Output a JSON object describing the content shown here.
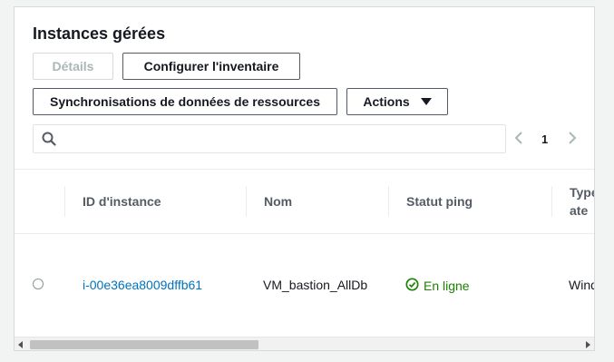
{
  "panel": {
    "title": "Instances gérées",
    "buttons": {
      "details": "Détails",
      "configure_inventory": "Configurer l'inventaire",
      "resource_data_sync": "Synchronisations de données de ressources",
      "actions": "Actions"
    }
  },
  "search": {
    "placeholder": "",
    "value": ""
  },
  "pagination": {
    "current_page": "1"
  },
  "table": {
    "columns": [
      "ID d'instance",
      "Nom",
      "Statut ping",
      "Type plate"
    ],
    "rows": [
      {
        "instance_id": "i-00e36ea8009dffb61",
        "name": "VM_bastion_AllDb",
        "ping_status": "En ligne",
        "platform_type": "Wind"
      }
    ]
  },
  "colors": {
    "link": "#0073bb",
    "online": "#1d8102",
    "border": "#545b64"
  }
}
